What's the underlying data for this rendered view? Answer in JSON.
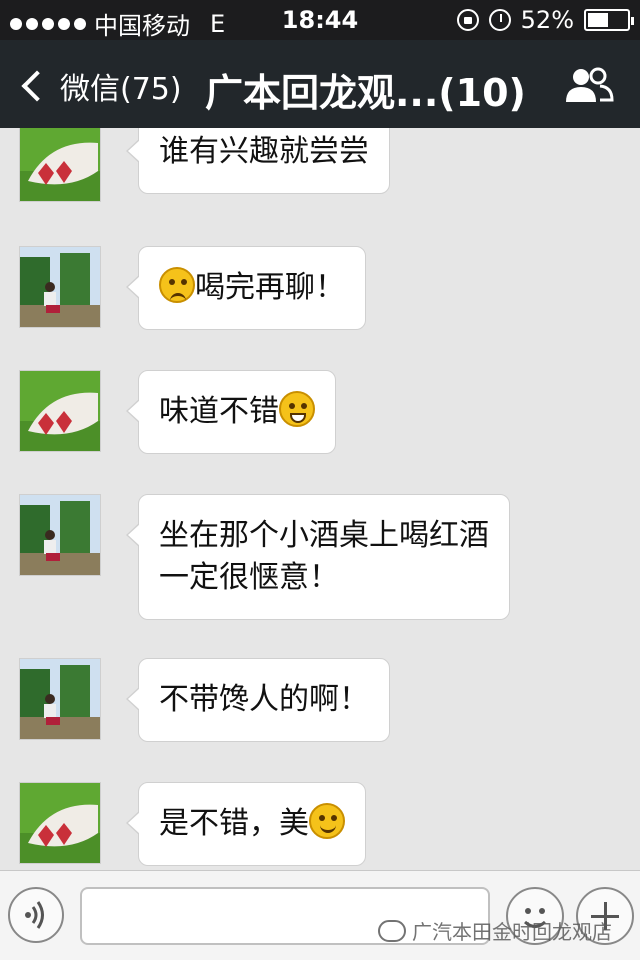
{
  "status_bar": {
    "carrier": "中国移动",
    "network": "E",
    "time": "18:44",
    "battery_text": "52%",
    "battery_level": 0.52
  },
  "nav": {
    "back_label": "微信(75)",
    "title": "广本回龙观...(10)"
  },
  "messages": [
    {
      "avatar": "hearts",
      "text": "谁有兴趣就尝尝"
    },
    {
      "avatar": "woman",
      "text_before": "",
      "emoji": "dizzy-face-emoji",
      "text": "喝完再聊！"
    },
    {
      "avatar": "hearts",
      "text": "味道不错",
      "emoji": "grin-emoji"
    },
    {
      "avatar": "woman",
      "lines": [
        "坐在那个小酒桌上喝红酒",
        "一定很惬意！"
      ]
    },
    {
      "avatar": "woman",
      "text": "不带馋人的啊！"
    },
    {
      "avatar": "hearts",
      "text": "是不错，美",
      "emoji": "drool-emoji"
    }
  ],
  "watermark": "广汽本田金时回龙观店",
  "colors": {
    "nav_bg": "#22272b",
    "chat_bg": "#e6e6e6",
    "bubble_bg": "#ffffff"
  }
}
